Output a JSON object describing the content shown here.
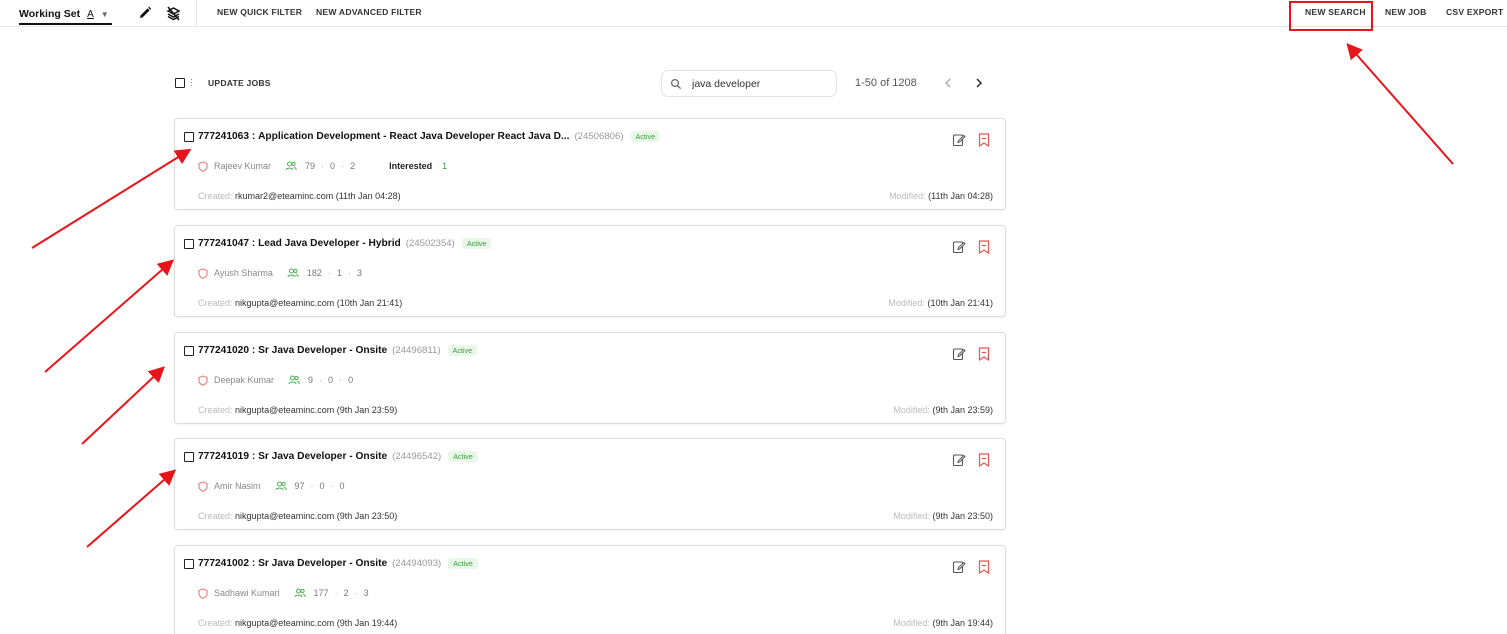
{
  "toolbar": {
    "working_set_label": "Working Set",
    "working_set_letter": "A",
    "new_quick_filter": "NEW QUICK FILTER",
    "new_advanced_filter": "NEW ADVANCED FILTER",
    "new_search": "NEW SEARCH",
    "new_job": "NEW JOB",
    "csv_export": "CSV EXPORT"
  },
  "list_controls": {
    "update_jobs": "UPDATE JOBS",
    "search_value": "java developer",
    "pagination": "1-50 of 1208"
  },
  "colors": {
    "annotation_red": "#e8141b",
    "status_green": "#3a9b3a",
    "bookmark_red": "#e85555"
  },
  "jobs": [
    {
      "id": "777241063 :",
      "title": "Application Development - React Java Developer React Java D...",
      "ref": "(24506806)",
      "status": "Active",
      "recruiter": "Rajeev Kumar",
      "stat1": "79",
      "stat2": "0",
      "stat3": "2",
      "interested_label": "Interested",
      "interested_count": "1",
      "created_label": "Created:",
      "created_value": "rkumar2@eteaminc.com (11th Jan 04:28)",
      "modified_label": "Modified:",
      "modified_value": "(11th Jan 04:28)"
    },
    {
      "id": "777241047 :",
      "title": "Lead Java Developer - Hybrid",
      "ref": "(24502354)",
      "status": "Active",
      "recruiter": "Ayush Sharma",
      "stat1": "182",
      "stat2": "1",
      "stat3": "3",
      "created_label": "Created:",
      "created_value": "nikgupta@eteaminc.com (10th Jan 21:41)",
      "modified_label": "Modified:",
      "modified_value": "(10th Jan 21:41)"
    },
    {
      "id": "777241020 :",
      "title": "Sr Java Developer - Onsite",
      "ref": "(24496811)",
      "status": "Active",
      "recruiter": "Deepak Kumar",
      "stat1": "9",
      "stat2": "0",
      "stat3": "0",
      "created_label": "Created:",
      "created_value": "nikgupta@eteaminc.com (9th Jan 23:59)",
      "modified_label": "Modified:",
      "modified_value": "(9th Jan 23:59)"
    },
    {
      "id": "777241019 :",
      "title": "Sr Java Developer - Onsite",
      "ref": "(24496542)",
      "status": "Active",
      "recruiter": "Amir Nasim",
      "stat1": "97",
      "stat2": "0",
      "stat3": "0",
      "created_label": "Created:",
      "created_value": "nikgupta@eteaminc.com (9th Jan 23:50)",
      "modified_label": "Modified:",
      "modified_value": "(9th Jan 23:50)"
    },
    {
      "id": "777241002 :",
      "title": "Sr Java Developer - Onsite",
      "ref": "(24494093)",
      "status": "Active",
      "recruiter": "Sadhawi Kumari",
      "stat1": "177",
      "stat2": "2",
      "stat3": "3",
      "created_label": "Created:",
      "created_value": "nikgupta@eteaminc.com (9th Jan 19:44)",
      "modified_label": "Modified:",
      "modified_value": "(9th Jan 19:44)"
    }
  ]
}
